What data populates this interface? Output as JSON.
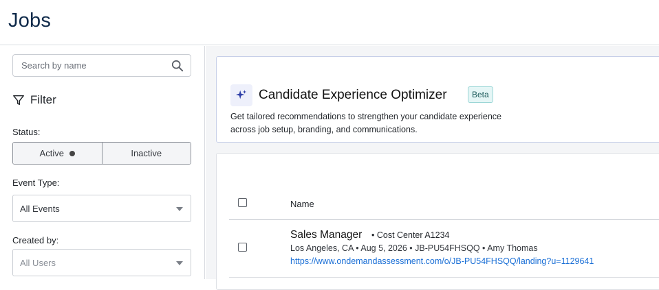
{
  "header": {
    "title": "Jobs"
  },
  "sidebar": {
    "search": {
      "placeholder": "Search by name",
      "icon": "search-icon"
    },
    "filter": {
      "title": "Filter",
      "icon": "filter-icon"
    },
    "status": {
      "label": "Status:",
      "options": [
        "Active",
        "Inactive"
      ],
      "selected": "Active"
    },
    "event_type": {
      "label": "Event Type:",
      "value": "All Events"
    },
    "created_by": {
      "label": "Created by:",
      "value": "All Users"
    }
  },
  "optimizer": {
    "icon": "sparkle-icon",
    "title": "Candidate Experience Optimizer",
    "badge": "Beta",
    "description_line1": "Get tailored recommendations to strengthen your candidate experience",
    "description_line2": "across job setup, branding, and communications."
  },
  "jobs_table": {
    "columns": {
      "name": "Name"
    },
    "rows": [
      {
        "title": "Sales Manager",
        "cost_center": "• Cost Center A1234",
        "meta": "Los Angeles, CA • Aug 5, 2026 • JB-PU54FHSQQ • Amy Thomas",
        "link": "https://www.ondemandassessment.com/o/JB-PU54FHSQQ/landing?u=1129641"
      }
    ]
  },
  "colors": {
    "heading": "#0f2a4a",
    "link": "#1a6fd6",
    "beta_bg": "#e5f6f6",
    "beta_border": "#9bd6d6",
    "panel_bg": "#f4f5f7"
  }
}
